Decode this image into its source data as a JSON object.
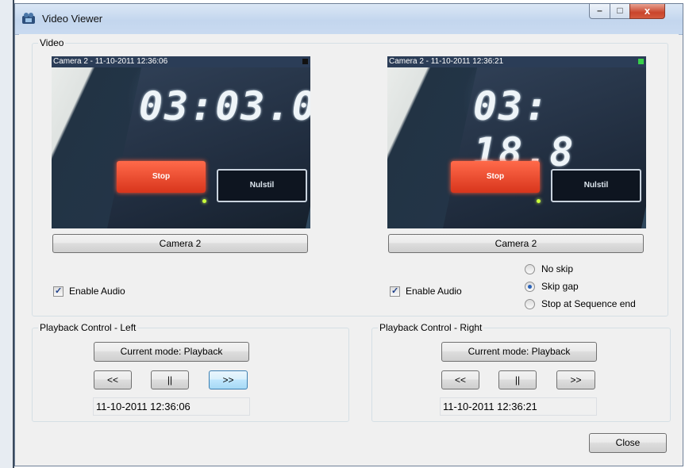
{
  "window": {
    "title": "Video Viewer",
    "minimize": "–",
    "maximize": "□",
    "close": "x"
  },
  "video_group": {
    "label": "Video",
    "left": {
      "stamp": "Camera 2 - 11-10-2011 12:36:06",
      "display_digits": "03:03.0",
      "red_button_text": "Stop",
      "dark_button_text": "Nulstil",
      "rec_color": "#111111",
      "camera_button": "Camera 2",
      "enable_audio": "Enable Audio"
    },
    "right": {
      "stamp": "Camera 2 - 11-10-2011 12:36:21",
      "display_digits": "03: 18.8",
      "red_button_text": "Stop",
      "dark_button_text": "Nulstil",
      "rec_color": "#38d04a",
      "camera_button": "Camera 2",
      "enable_audio": "Enable Audio"
    },
    "skip_options": [
      {
        "label": "No skip",
        "selected": false
      },
      {
        "label": "Skip gap",
        "selected": true
      },
      {
        "label": "Stop at Sequence end",
        "selected": false
      }
    ]
  },
  "playback_left": {
    "label": "Playback Control - Left",
    "mode_button": "Current mode: Playback",
    "rewind": "<<",
    "pause": "||",
    "forward": ">>",
    "time": "11-10-2011  12:36:06"
  },
  "playback_right": {
    "label": "Playback Control - Right",
    "mode_button": "Current mode: Playback",
    "rewind": "<<",
    "pause": "||",
    "forward": ">>",
    "time": "11-10-2011  12:36:21"
  },
  "close_button": "Close"
}
